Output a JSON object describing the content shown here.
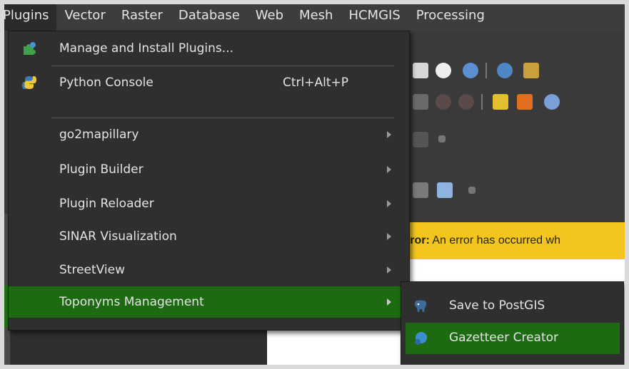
{
  "menubar": {
    "items": [
      {
        "label": "Plugins"
      },
      {
        "label": "Vector"
      },
      {
        "label": "Raster"
      },
      {
        "label": "Database"
      },
      {
        "label": "Web"
      },
      {
        "label": "Mesh"
      },
      {
        "label": "HCMGIS"
      },
      {
        "label": "Processing"
      }
    ]
  },
  "plugins_menu": {
    "manage_label": "Manage and Install Plugins...",
    "python_label": "Python Console",
    "python_shortcut": "Ctrl+Alt+P",
    "items": [
      {
        "label": "go2mapillary"
      },
      {
        "label": "Plugin Builder"
      },
      {
        "label": "Plugin Reloader"
      },
      {
        "label": "SINAR Visualization"
      },
      {
        "label": "StreetView"
      },
      {
        "label": "Toponyms Management"
      }
    ]
  },
  "submenu": {
    "items": [
      {
        "label": "Save to PostGIS"
      },
      {
        "label": "Gazetteer Creator"
      }
    ]
  },
  "message_bar": {
    "prefix": "rror:",
    "text": " An error has occurred wh"
  },
  "colors": {
    "menu_bg": "#2f2f2f",
    "highlight": "#1d6a13",
    "message_bar": "#f3c51d"
  }
}
